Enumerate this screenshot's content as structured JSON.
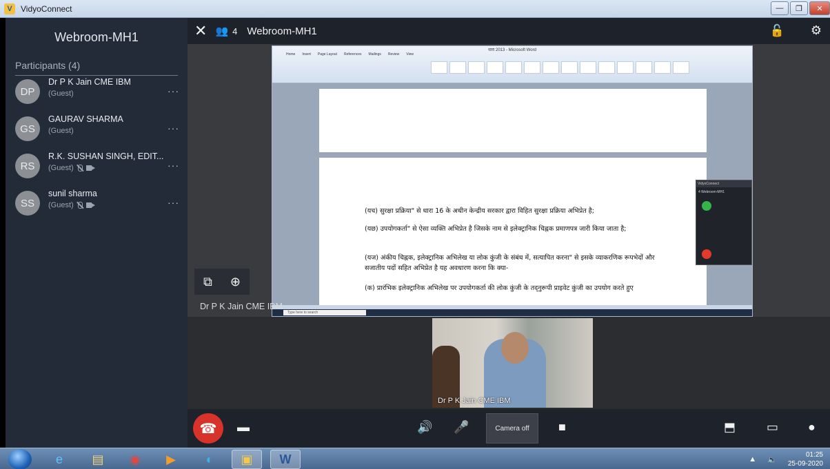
{
  "window": {
    "title": "VidyoConnect",
    "minimize": "—",
    "restore": "❐",
    "close": "✕"
  },
  "sidebar": {
    "room_name": "Webroom-MH1",
    "participants_header": "Participants (4)",
    "participants": [
      {
        "initials": "DP",
        "name": "Dr P K Jain CME IBM",
        "role": "(Guest)",
        "muted": false
      },
      {
        "initials": "GS",
        "name": "GAURAV SHARMA",
        "role": "(Guest)",
        "muted": false
      },
      {
        "initials": "RS",
        "name": "R.K. SUSHAN SINGH, EDIT...",
        "role": "(Guest)",
        "muted": true
      },
      {
        "initials": "SS",
        "name": "sunil sharma",
        "role": "(Guest)",
        "muted": true
      }
    ],
    "more_label": "···"
  },
  "topbar": {
    "close_glyph": "✕",
    "people_glyph": "👥",
    "participant_count": "4",
    "room_name": "Webroom-MH1",
    "lock_glyph": "🔓",
    "gear_glyph": "⚙"
  },
  "shared_screen": {
    "word_title": "धारा 2013 - Microsoft Word",
    "ribbon_tabs": [
      "Home",
      "Insert",
      "Page Layout",
      "References",
      "Mailings",
      "Review",
      "View"
    ],
    "paragraphs": [
      "(यच) सुरक्षा प्रक्रिया\" से धारा 16 के अधीन केन्द्रीय सरकार द्वारा विहित सुरक्षा प्रक्रिया अभिप्रेत है;",
      "(यछ) उपयोगकर्ता\" से ऐसा व्यक्ति अभिप्रेत है जिसके नाम से  इलेक्ट्रानिक चिह्नक प्रमाणपत्र जारी किया  जाता है;",
      "(यज) अंकीय चिह्नक, इलेक्ट्रानिक अभिलेख या लोक कुंजी के संबंध में, सत्यापित करना\" से इसके व्याकरणिक रूपभेदों और सजातीय पदों सहित अभिप्रेत है यह अवधारण करना कि क्या-",
      "(क) प्रारंभिक इलेक्ट्रानिक अभिलेख पर उपयोगकर्ता की लोक कुंजी के तद्नुरूपी प्राइवेट कुंजी का उपयोग करते हुए"
    ],
    "mini_app_title": "VidyoConnect",
    "mini_room": "4  Webroom-MH1",
    "taskbar_search": "Type here to search"
  },
  "share_controls": {
    "share_glyph": "⧉",
    "zoom_glyph": "⊕"
  },
  "presenter_label": "Dr P K Jain CME IBM",
  "self_view_label": "Dr P K Jain CME IBM",
  "controls": {
    "hangup_glyph": "☎",
    "layout_glyph": "▬",
    "speaker_glyph": "🔊",
    "mic_glyph": "🎤",
    "camera_off_label": "Camera off",
    "camera_glyph": "■",
    "share_glyph": "⬒",
    "screen_glyph": "▭",
    "chat_glyph": "●"
  },
  "taskbar": {
    "apps": [
      "e",
      "▤",
      "◉",
      "▶",
      "◐",
      "▣",
      "W"
    ],
    "tray_arrow": "▲",
    "volume_glyph": "🔈",
    "time": "01:25",
    "date": "25-09-2020"
  }
}
